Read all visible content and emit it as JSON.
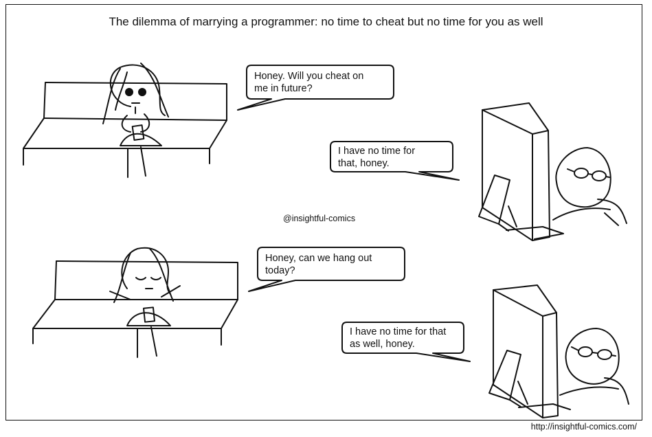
{
  "comic": {
    "title": "The dilemma of marrying a programmer: no time to cheat but no time for you as well",
    "watermark": "@insightful-comics",
    "url": "http://insightful-comics.com/",
    "panel1": {
      "wife_line": [
        "Honey. Will you cheat on",
        "me in future?"
      ],
      "husband_line": [
        "I have no time for",
        "that, honey."
      ]
    },
    "panel2": {
      "wife_line": [
        "Honey, can we hang out",
        "today?"
      ],
      "husband_line": [
        "I have no time for that",
        "as well, honey."
      ]
    }
  }
}
